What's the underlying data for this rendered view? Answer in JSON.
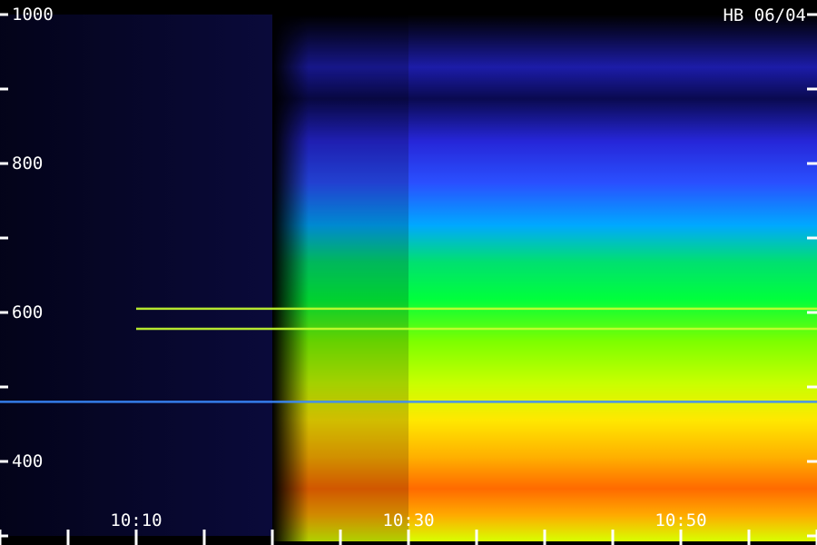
{
  "chart_data": {
    "type": "heatmap",
    "title": "HB 06/04",
    "x_tick_labels": [
      "10:10",
      "10:30",
      "10:50"
    ],
    "y_tick_labels": [
      "1000",
      "800",
      "600",
      "400"
    ],
    "ylim": [
      300,
      1000
    ],
    "y_tick_step": 100,
    "colormap": [
      "#000000",
      "#10106a",
      "#2a2aff",
      "#00a8ff",
      "#00ff3c",
      "#a8ff00",
      "#ffe800",
      "#ff8a00",
      "#ff1e00"
    ],
    "onset_time": "10:20",
    "horizontal_lines": [
      {
        "y": 605,
        "start": "10:10"
      },
      {
        "y": 578,
        "start": "10:10"
      },
      {
        "y": 480,
        "start": "10:00"
      }
    ],
    "grid": false,
    "legend": "none"
  }
}
